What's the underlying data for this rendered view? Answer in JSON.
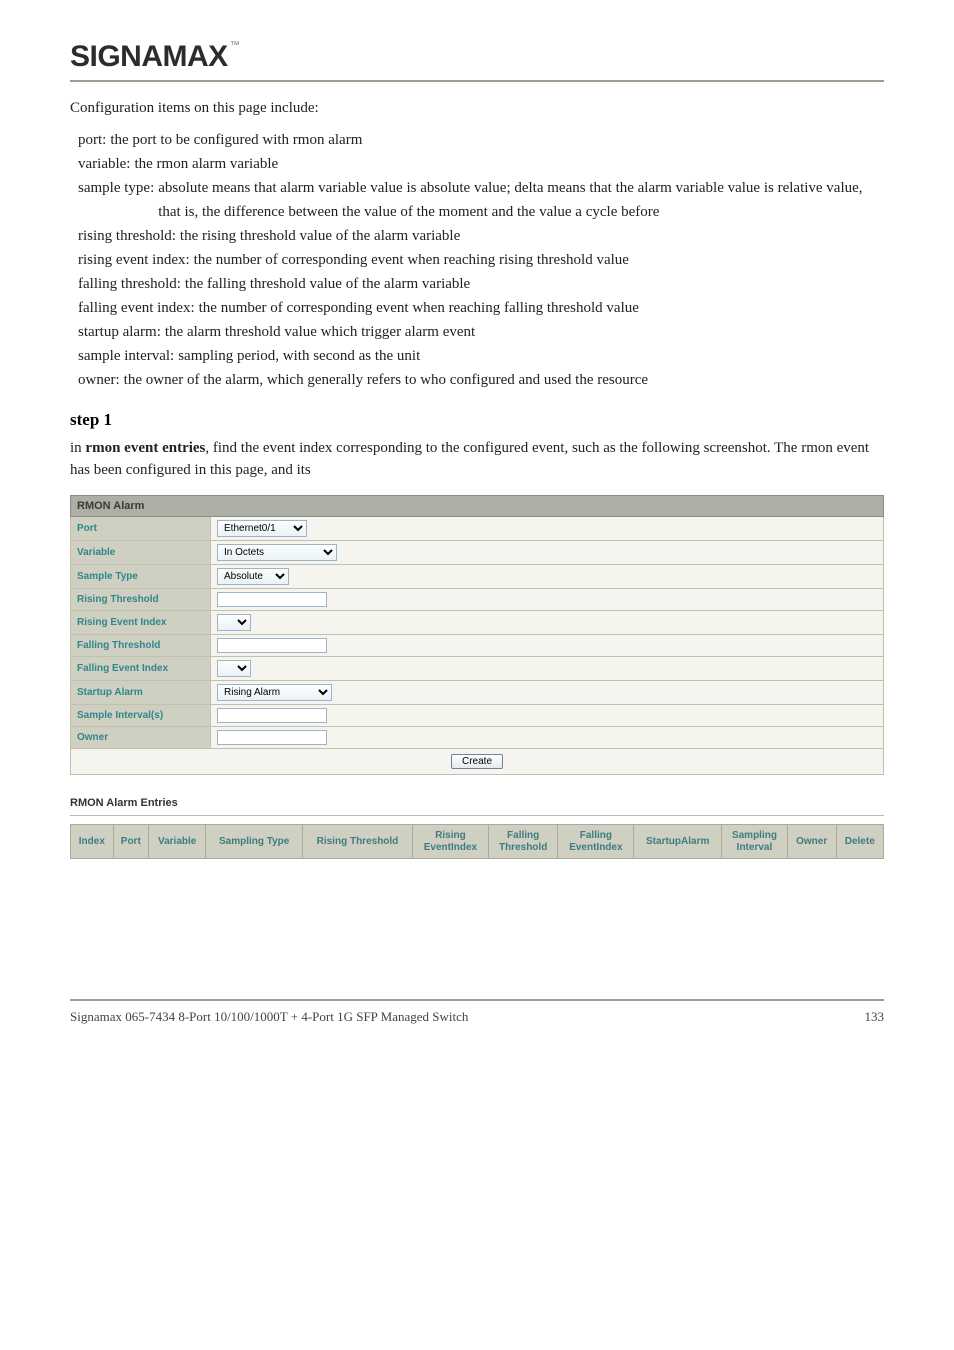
{
  "brand": {
    "name": "SIGNAMAX",
    "tm": "™"
  },
  "intro": "Configuration items on this page include:",
  "items": [
    {
      "term": "port",
      "desc": "the port to be configured with rmon alarm"
    },
    {
      "term": "variable",
      "desc": "the rmon alarm variable"
    },
    {
      "term": "sample type",
      "desc": "absolute means that alarm variable value is absolute value; delta means that the alarm variable value is relative value, that is, the difference between the value of the moment and the value a cycle before"
    },
    {
      "term": "rising threshold",
      "desc": "the rising threshold value of the alarm variable"
    },
    {
      "term": "rising event index",
      "desc": "the number of corresponding event when reaching rising threshold value"
    },
    {
      "term": "falling threshold",
      "desc": "the falling threshold value of the alarm variable"
    },
    {
      "term": "falling event index",
      "desc": "the number of corresponding event when reaching falling threshold value"
    },
    {
      "term": "startup alarm",
      "desc": "the alarm threshold value which trigger alarm event"
    },
    {
      "term": "sample interval",
      "desc": "sampling period, with second as the unit"
    },
    {
      "term": "owner",
      "desc": "the owner of the alarm, which generally refers to who configured and used the resource"
    }
  ],
  "step1": {
    "heading": "step 1",
    "text_before": "in ",
    "bold": "rmon event entries",
    "text_after": ", find the event index corresponding to the configured event, such as the following screenshot. The rmon event has been configured in this page, and its"
  },
  "form": {
    "title": "RMON Alarm",
    "fields": {
      "port": {
        "label": "Port",
        "value": "Ethernet0/1"
      },
      "variable": {
        "label": "Variable",
        "value": "In Octets"
      },
      "sample_type": {
        "label": "Sample Type",
        "value": "Absolute"
      },
      "rising_threshold": {
        "label": "Rising Threshold",
        "value": ""
      },
      "rising_event_index": {
        "label": "Rising Event Index",
        "value": ""
      },
      "falling_threshold": {
        "label": "Falling Threshold",
        "value": ""
      },
      "falling_event_index": {
        "label": "Falling Event Index",
        "value": ""
      },
      "startup_alarm": {
        "label": "Startup Alarm",
        "value": "Rising Alarm"
      },
      "sample_interval": {
        "label": "Sample Interval(s)",
        "value": ""
      },
      "owner": {
        "label": "Owner",
        "value": ""
      }
    },
    "create_label": "Create"
  },
  "entries": {
    "title": "RMON Alarm Entries",
    "columns": [
      "Index",
      "Port",
      "Variable",
      "Sampling Type",
      "Rising Threshold",
      "Rising\nEventIndex",
      "Falling\nThreshold",
      "Falling\nEventIndex",
      "StartupAlarm",
      "Sampling\nInterval",
      "Owner",
      "Delete"
    ]
  },
  "footer": {
    "left": "Signamax 065-7434 8-Port 10/100/1000T + 4-Port 1G SFP Managed Switch",
    "right": "133"
  }
}
